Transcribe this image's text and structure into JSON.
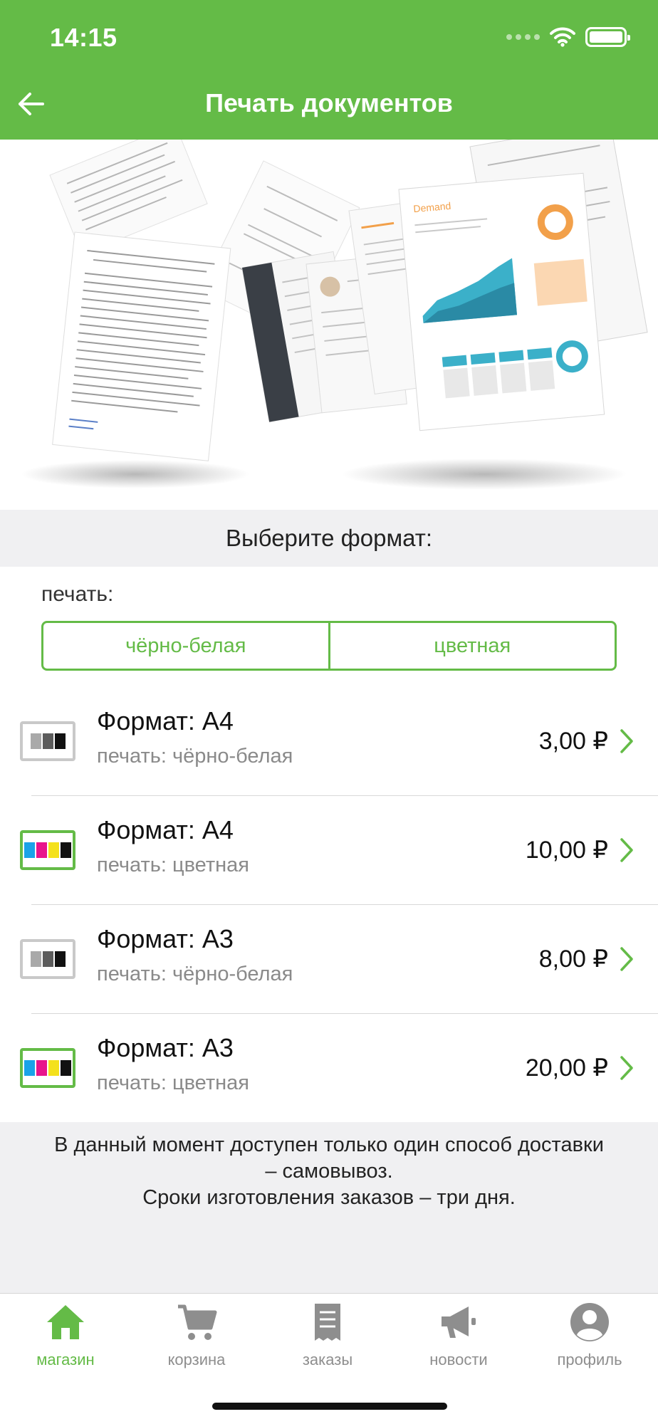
{
  "status_bar": {
    "time": "14:15"
  },
  "header": {
    "title": "Печать документов",
    "back_icon": "arrow-left-icon"
  },
  "format_section": {
    "title": "Выберите формат:"
  },
  "print_selector": {
    "label": "печать:",
    "options": [
      "чёрно-белая",
      "цветная"
    ]
  },
  "formats": [
    {
      "title": "Формат: А4",
      "subtitle": "печать: чёрно-белая",
      "price": "3,00 ₽",
      "icon": "bw-print-icon"
    },
    {
      "title": "Формат: А4",
      "subtitle": "печать: цветная",
      "price": "10,00 ₽",
      "icon": "color-print-icon"
    },
    {
      "title": "Формат: А3",
      "subtitle": "печать: чёрно-белая",
      "price": "8,00 ₽",
      "icon": "bw-print-icon"
    },
    {
      "title": "Формат: А3",
      "subtitle": "печать: цветная",
      "price": "20,00 ₽",
      "icon": "color-print-icon"
    }
  ],
  "info": {
    "lines": [
      "В данный момент доступен только один способ доставки",
      "– самовывоз.",
      "Сроки изготовления заказов – три дня."
    ]
  },
  "tabbar": {
    "tabs": [
      {
        "label": "магазин",
        "icon": "home-icon",
        "active": true
      },
      {
        "label": "корзина",
        "icon": "cart-icon",
        "active": false
      },
      {
        "label": "заказы",
        "icon": "receipt-icon",
        "active": false
      },
      {
        "label": "новости",
        "icon": "megaphone-icon",
        "active": false
      },
      {
        "label": "профиль",
        "icon": "profile-icon",
        "active": false
      }
    ]
  },
  "colors": {
    "accent": "#64bb47",
    "muted": "#8e8e8e",
    "panel": "#f0f0f2"
  }
}
